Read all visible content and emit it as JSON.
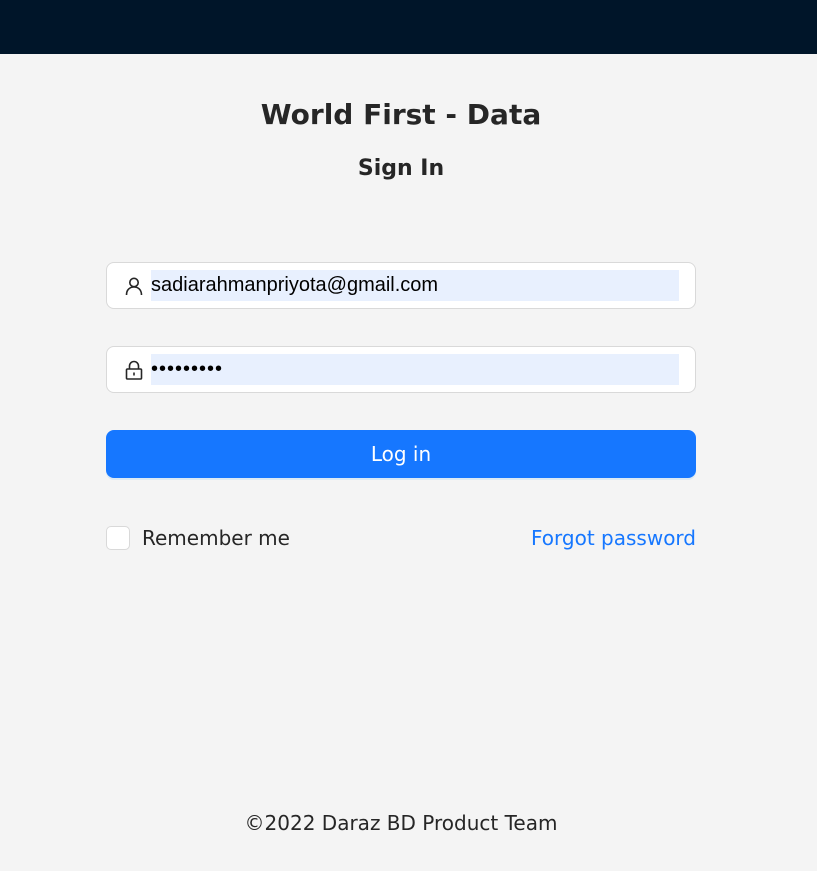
{
  "header": {
    "background": "#001529"
  },
  "login": {
    "title": "World First - Data",
    "subtitle": "Sign In",
    "email_value": "sadiarahmanpriyota@gmail.com",
    "password_value": "•••••••••",
    "login_label": "Log in",
    "remember_label": "Remember me",
    "remember_checked": false,
    "forgot_label": "Forgot password"
  },
  "icons": {
    "email": "user-icon",
    "password": "lock-icon"
  },
  "colors": {
    "primary": "#1677ff",
    "autofill": "#e8f0fe",
    "page": "#f4f4f4"
  },
  "footer": {
    "text": "©2022 Daraz BD Product Team"
  }
}
